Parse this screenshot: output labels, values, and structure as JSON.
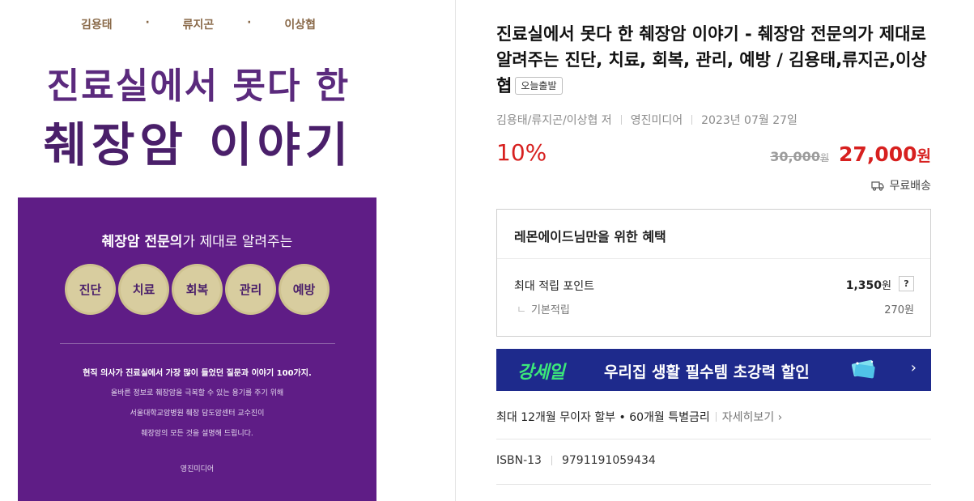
{
  "cover": {
    "authors": [
      "김용태",
      "류지곤",
      "이상협"
    ],
    "dot": "·",
    "title_line1": "진료실에서 못다 한",
    "title_line2": "췌장암 이야기",
    "box_head_bold": "췌장암 전문의",
    "box_head_rest": "가 제대로 알려주는",
    "badges": [
      "진단",
      "치료",
      "회복",
      "관리",
      "예방"
    ],
    "bold_line": "현직 의사가 진료실에서 가장 많이 들었던 질문과 이야기 100가지.",
    "text_lines": [
      "올바른 정보로 췌장암을 극복할 수 있는 용기를 주기 위해",
      "서울대학교암병원 췌장 담도암센터 교수진이",
      "췌장암의 모든 것을 설명해 드립니다."
    ],
    "publisher": "영진미디어",
    "colors": {
      "purple": "#5f1d86",
      "badge": "#d8cd9f",
      "title": "#4a1f6a"
    }
  },
  "product": {
    "title": "진료실에서 못다 한 췌장암 이야기 - 췌장암 전문의가 제대로 알려주는 진단, 치료, 회복, 관리, 예방 / 김용태,류지곤,이상협",
    "tag": "오늘출발",
    "author": "김용태/류지곤/이상협 저",
    "publisher": "영진미디어",
    "date": "2023년 07월 27일",
    "discount": "10%",
    "original_price": "30,000",
    "sale_price": "27,000",
    "won": "원",
    "shipping": "무료배송",
    "shipping_icon": "truck-icon",
    "accent_color": "#d7201f"
  },
  "benefit": {
    "title": "레몬에이드님만을 위한 혜택",
    "point_label": "최대 적립 포인트",
    "point_value": "1,350",
    "help": "?",
    "base_corner": "ㄴ",
    "base_label": "기본적립",
    "base_value": "270원"
  },
  "banner": {
    "logo": "강세일",
    "text": "우리집 생활 필수템 초강력 할인",
    "arrow": "›",
    "bg_color": "#1e2a8c",
    "logo_color": "#3be87a"
  },
  "installment": {
    "text": "최대 12개월 무이자 할부 • 60개월 특별금리",
    "more": "자세히보기 ›"
  },
  "isbn": {
    "label": "ISBN-13",
    "value": "9791191059434"
  }
}
